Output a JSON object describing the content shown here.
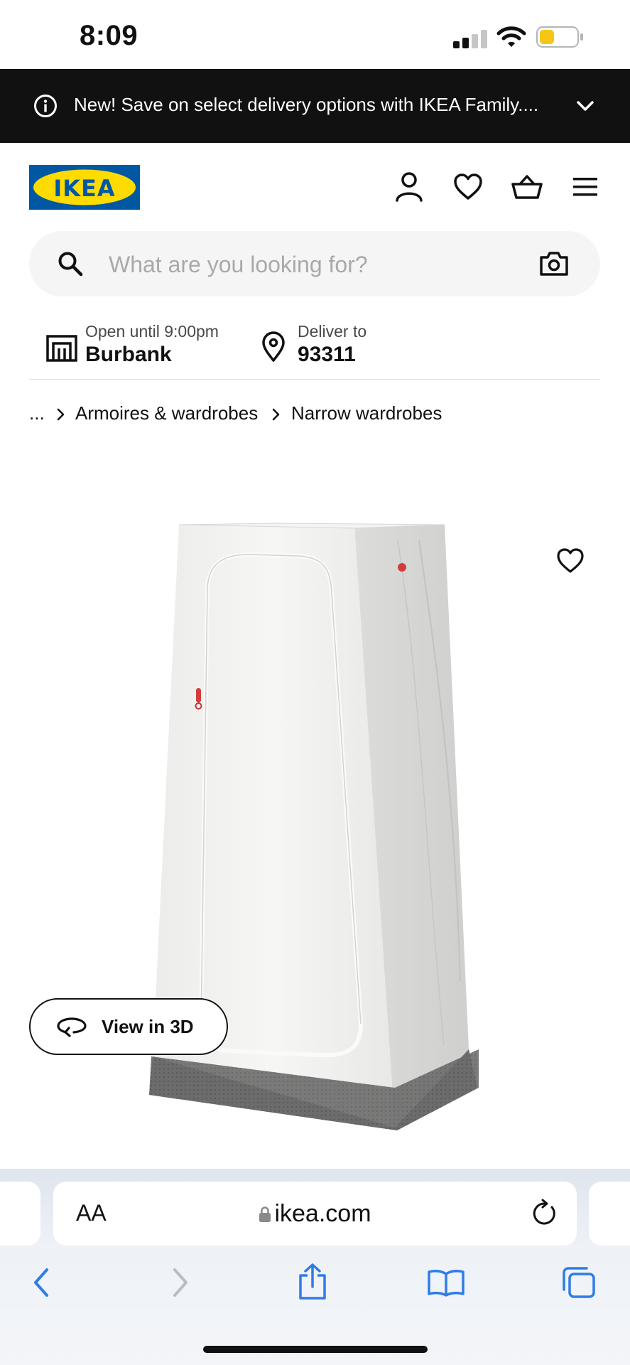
{
  "status_bar": {
    "time": "8:09",
    "battery_level": 0.4
  },
  "banner": {
    "text": "New! Save on select delivery options with IKEA Family...."
  },
  "header": {
    "logo_text": "IKEA"
  },
  "search": {
    "placeholder": "What are you looking for?"
  },
  "store": {
    "hours": "Open until 9:00pm",
    "name": "Burbank"
  },
  "delivery": {
    "label": "Deliver to",
    "zip": "93311"
  },
  "breadcrumb": {
    "items": [
      "...",
      "Armoires & wardrobes",
      "Narrow wardrobes"
    ]
  },
  "product": {
    "view3d_label": "View in 3D"
  },
  "browser": {
    "aa_label": "AA",
    "url": "ikea.com"
  },
  "colors": {
    "ikea_blue": "#0058a3",
    "ikea_yellow": "#ffdb00",
    "banner_bg": "#111111",
    "safari_blue": "#2f7ce6"
  }
}
